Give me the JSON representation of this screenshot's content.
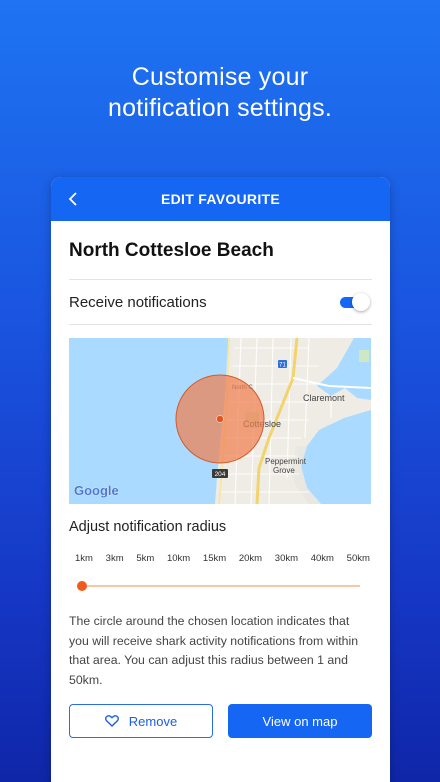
{
  "promo": {
    "line1": "Customise your",
    "line2": "notification settings."
  },
  "header": {
    "title": "EDIT FAVOURITE",
    "back_icon": "chevron-left-icon"
  },
  "place": {
    "title": "North Cottesloe Beach"
  },
  "notifications": {
    "label": "Receive notifications",
    "enabled": true
  },
  "map": {
    "labels": {
      "claremont": "Claremont",
      "cottesloe": "Cottesloe",
      "peppermint1": "Peppermint",
      "peppermint2": "Grove",
      "north": "North C",
      "road71": "71",
      "road204": "204",
      "google": "Google"
    }
  },
  "radius": {
    "label": "Adjust notification radius",
    "options": [
      "1km",
      "3km",
      "5km",
      "10km",
      "15km",
      "20km",
      "30km",
      "40km",
      "50km"
    ],
    "selected": "1km"
  },
  "description": "The circle around the chosen location indicates that you will receive shark activity notifications from within that area. You can adjust this radius between 1 and 50km.",
  "actions": {
    "remove_label": "Remove",
    "view_label": "View on map"
  },
  "colors": {
    "primary": "#1566f2",
    "accent": "#ee5b1c"
  }
}
